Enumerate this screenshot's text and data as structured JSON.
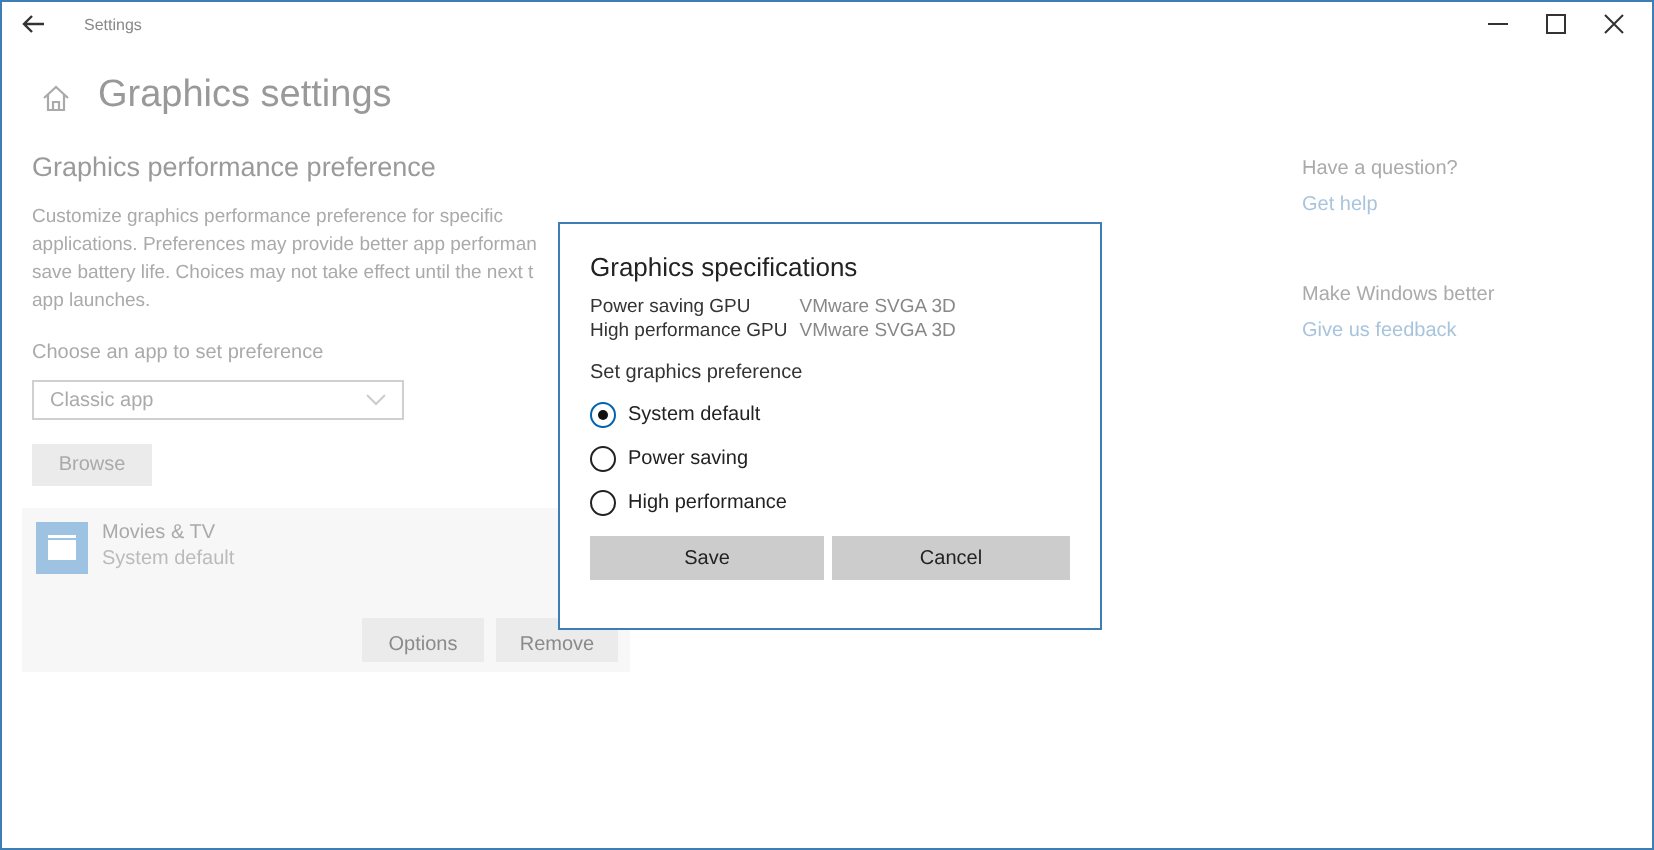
{
  "window": {
    "title": "Settings",
    "controls": [
      {
        "kind": "minimize"
      },
      {
        "kind": "maximize"
      },
      {
        "kind": "close"
      }
    ]
  },
  "page": {
    "title": "Graphics settings",
    "section_title": "Graphics performance preference",
    "description_lines": [
      "Customize graphics performance preference for specific",
      "applications. Preferences may provide better app performan",
      "save battery life. Choices may not take effect until the next t",
      "app launches."
    ],
    "choose_label": "Choose an app to set preference",
    "app_type": {
      "value": "Classic app"
    },
    "browse_button": "Browse",
    "apps": [
      {
        "name": "Movies & TV",
        "preference": "System default",
        "buttons": [
          "Options",
          "Remove"
        ]
      }
    ]
  },
  "sidebar": {
    "sections": [
      {
        "heading": "Have a question?",
        "link": "Get help"
      },
      {
        "heading": "Make Windows better",
        "link": "Give us feedback"
      }
    ]
  },
  "dialog": {
    "title": "Graphics specifications",
    "specs": [
      {
        "label": "Power saving GPU",
        "value": "VMware SVGA 3D"
      },
      {
        "label": "High performance GPU",
        "value": "VMware SVGA 3D"
      }
    ],
    "preference_label": "Set graphics preference",
    "options": [
      {
        "label": "System default",
        "selected": true
      },
      {
        "label": "Power saving",
        "selected": false
      },
      {
        "label": "High performance",
        "selected": false
      }
    ],
    "buttons": [
      "Save",
      "Cancel"
    ]
  }
}
